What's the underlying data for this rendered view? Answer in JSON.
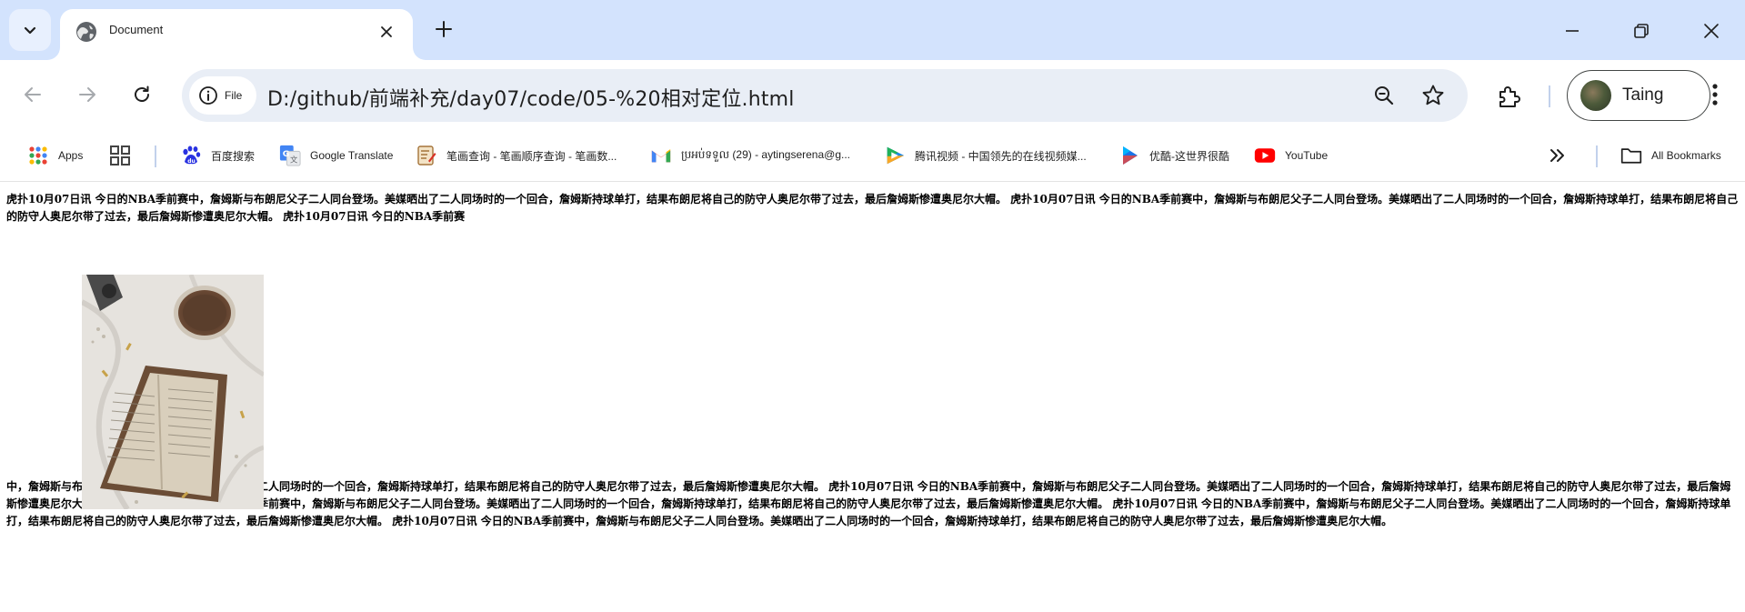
{
  "tab": {
    "title": "Document"
  },
  "toolbar": {
    "site_chip_label": "File",
    "url": "D:/github/前端补充/day07/code/05-%20相对定位.html",
    "profile_name": "Taing"
  },
  "bookmarks": {
    "items": [
      {
        "label": "Apps",
        "icon": "apps-grid-icon"
      },
      {
        "label": "",
        "icon": "tab-groups-icon"
      },
      {
        "label": "百度搜索",
        "icon": "baidu-paw-icon"
      },
      {
        "label": "Google Translate",
        "icon": "google-translate-icon"
      },
      {
        "label": "笔画查询 - 笔画顺序查询 - 笔画数...",
        "icon": "stroke-order-icon"
      },
      {
        "label": "ប្រអប់ទទួល (29) - aytingserena@g...",
        "icon": "gmail-icon"
      },
      {
        "label": "腾讯视频 - 中国领先的在线视频媒...",
        "icon": "tencent-video-icon"
      },
      {
        "label": "优酷-这世界很酷",
        "icon": "youku-icon"
      },
      {
        "label": "YouTube",
        "icon": "youtube-icon"
      }
    ],
    "all_bookmarks_label": "All Bookmarks"
  },
  "page": {
    "paragraph_1": "虎扑10月07日讯 今日的NBA季前赛中，詹姆斯与布朗尼父子二人同台登场。美媒晒出了二人同场时的一个回合，詹姆斯持球单打，结果布朗尼将自己的防守人奥尼尔带了过去，最后詹姆斯惨遭奥尼尔大帽。 虎扑10月07日讯 今日的NBA季前赛中，詹姆斯与布朗尼父子二人同台登场。美媒晒出了二人同场时的一个回合，詹姆斯持球单打，结果布朗尼将自己的防守人奥尼尔带了过去，最后詹姆斯惨遭奥尼尔大帽。 虎扑10月07日讯 今日的NBA季前赛",
    "paragraph_2": "中，詹姆斯与布朗尼父子二人同台登场。美媒晒出了二人同场时的一个回合，詹姆斯持球单打，结果布朗尼将自己的防守人奥尼尔带了过去，最后詹姆斯惨遭奥尼尔大帽。 虎扑10月07日讯 今日的NBA季前赛中，詹姆斯与布朗尼父子二人同台登场。美媒晒出了二人同场时的一个回合，詹姆斯持球单打，结果布朗尼将自己的防守人奥尼尔带了过去，最后詹姆斯惨遭奥尼尔大帽。 虎扑10月07日讯 今日的NBA季前赛中，詹姆斯与布朗尼父子二人同台登场。美媒晒出了二人同场时的一个回合，詹姆斯持球单打，结果布朗尼将自己的防守人奥尼尔带了过去，最后詹姆斯惨遭奥尼尔大帽。 虎扑10月07日讯 今日的NBA季前赛中，詹姆斯与布朗尼父子二人同台登场。美媒晒出了二人同场时的一个回合，詹姆斯持球单打，结果布朗尼将自己的防守人奥尼尔带了过去，最后詹姆斯惨遭奥尼尔大帽。 虎扑10月07日讯 今日的NBA季前赛中，詹姆斯与布朗尼父子二人同台登场。美媒晒出了二人同场时的一个回合，詹姆斯持球单打，结果布朗尼将自己的防守人奥尼尔带了过去，最后詹姆斯惨遭奥尼尔大帽。",
    "image_subject": "open book and coffee cup on linen"
  },
  "colors": {
    "tabstrip_bg": "#d3e3fd",
    "omnibox_bg": "#e9eef6",
    "youtube_red": "#ff0000"
  }
}
